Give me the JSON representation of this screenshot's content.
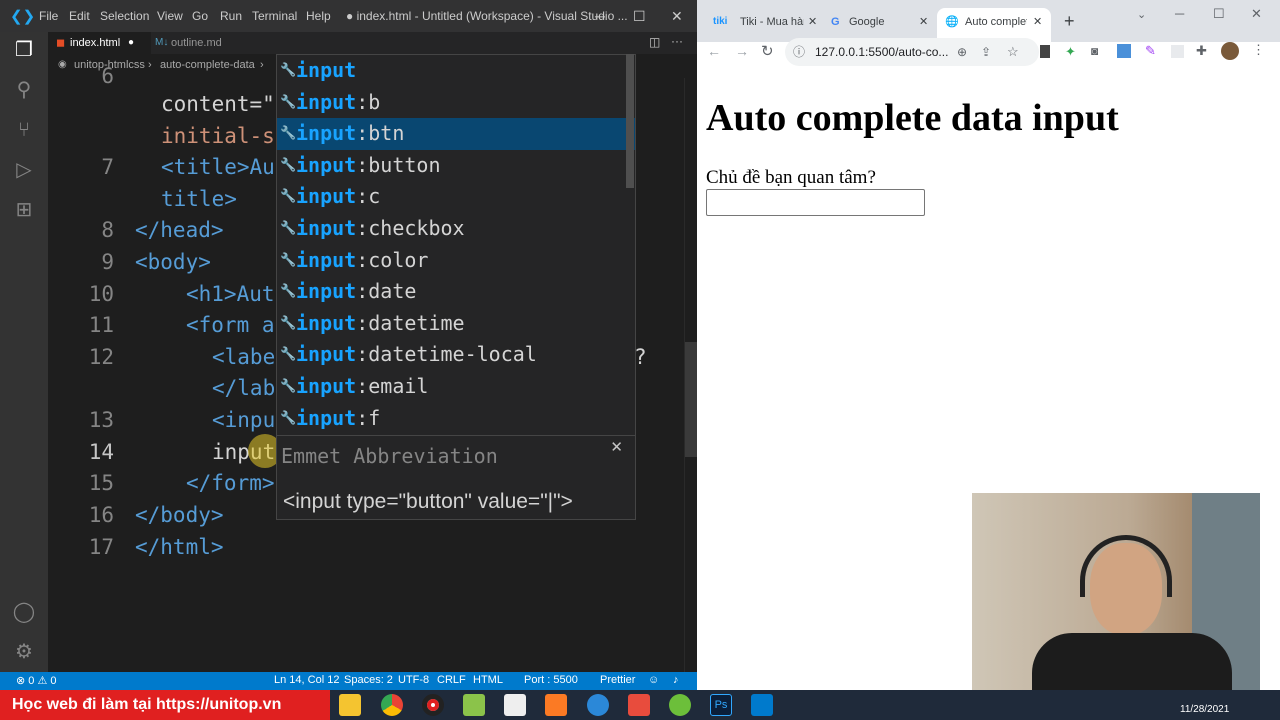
{
  "vscode": {
    "menu": [
      "File",
      "Edit",
      "Selection",
      "View",
      "Go",
      "Run",
      "Terminal",
      "Help"
    ],
    "window_title": "● index.html - Untitled (Workspace) - Visual Studio ...",
    "tabs": [
      {
        "label": "index.html",
        "modified": true
      },
      {
        "label": "outline.md",
        "modified": false
      }
    ],
    "breadcrumb": [
      "unitop-htmlcss",
      "auto-complete-data"
    ],
    "lines": [
      {
        "num": "6",
        "text": ""
      },
      {
        "num": "",
        "text": "content=\""
      },
      {
        "num": "",
        "text": "initial-s"
      },
      {
        "num": "7",
        "text": "<title>Au"
      },
      {
        "num": "",
        "text": "title>"
      },
      {
        "num": "8",
        "text": "</head>"
      },
      {
        "num": "9",
        "text": "<body>"
      },
      {
        "num": "10",
        "text": "<h1>Aut"
      },
      {
        "num": "11",
        "text": "<form a"
      },
      {
        "num": "12",
        "text": "<labe"
      },
      {
        "num": "",
        "text": "</lab"
      },
      {
        "num": "13",
        "text": "<inpu"
      },
      {
        "num": "14",
        "text": "input"
      },
      {
        "num": "15",
        "text": "</form>"
      },
      {
        "num": "16",
        "text": "</body>"
      },
      {
        "num": "17",
        "text": "</html>"
      }
    ],
    "line12_tail": "?",
    "suggestions": [
      {
        "match": "input",
        "rest": ""
      },
      {
        "match": "input",
        "rest": ":b"
      },
      {
        "match": "input",
        "rest": ":btn",
        "selected": true
      },
      {
        "match": "input",
        "rest": ":button"
      },
      {
        "match": "input",
        "rest": ":c"
      },
      {
        "match": "input",
        "rest": ":checkbox"
      },
      {
        "match": "input",
        "rest": ":color"
      },
      {
        "match": "input",
        "rest": ":date"
      },
      {
        "match": "input",
        "rest": ":datetime"
      },
      {
        "match": "input",
        "rest": ":datetime-local"
      },
      {
        "match": "input",
        "rest": ":email"
      },
      {
        "match": "input",
        "rest": ":f"
      }
    ],
    "details_title": "Emmet Abbreviation",
    "details_snippet": "<input type=\"button\" value=\"|\">",
    "status": {
      "problems": "⊗ 0 ⚠ 0",
      "position": "Ln 14, Col 12",
      "spaces": "Spaces: 2",
      "encoding": "UTF-8",
      "eol": "CRLF",
      "language": "HTML",
      "port": "Port : 5500",
      "prettier": "Prettier"
    }
  },
  "chrome": {
    "tabs": [
      {
        "label": "Tiki - Mua hàng"
      },
      {
        "label": "Google"
      },
      {
        "label": "Auto complete",
        "active": true
      }
    ],
    "url": "127.0.0.1:5500/auto-co...",
    "page": {
      "heading": "Auto complete data input",
      "label": "Chủ đề bạn quan tâm?",
      "input_value": ""
    }
  },
  "taskbar": {
    "promo": "Học web đi làm tại https://unitop.vn",
    "clock": "11/28/2021"
  },
  "colors": {
    "vscode_accent": "#007acc",
    "selection": "#094771",
    "match_highlight": "#18a3ff",
    "promo_bg": "#e02020"
  }
}
